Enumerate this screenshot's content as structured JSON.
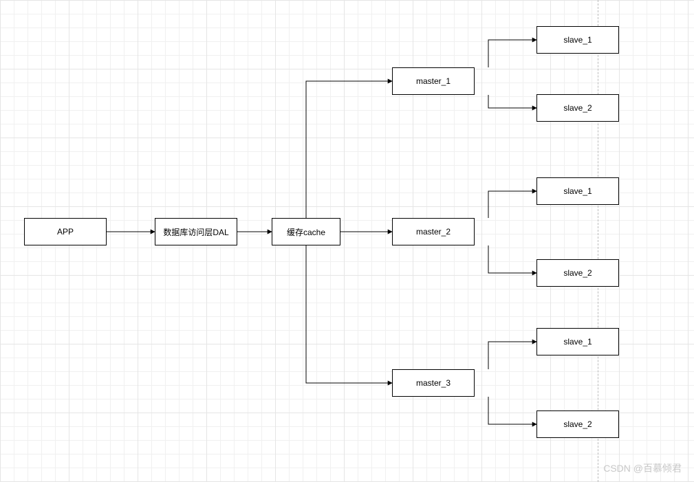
{
  "nodes": {
    "app": {
      "label": "APP"
    },
    "dal": {
      "label": "数据库访问层DAL"
    },
    "cache": {
      "label": "缓存cache"
    },
    "master1": {
      "label": "master_1"
    },
    "master2": {
      "label": "master_2"
    },
    "master3": {
      "label": "master_3"
    },
    "m1_slave1": {
      "label": "slave_1"
    },
    "m1_slave2": {
      "label": "slave_2"
    },
    "m2_slave1": {
      "label": "slave_1"
    },
    "m2_slave2": {
      "label": "slave_2"
    },
    "m3_slave1": {
      "label": "slave_1"
    },
    "m3_slave2": {
      "label": "slave_2"
    }
  },
  "watermark": "CSDN @百慕倾君"
}
